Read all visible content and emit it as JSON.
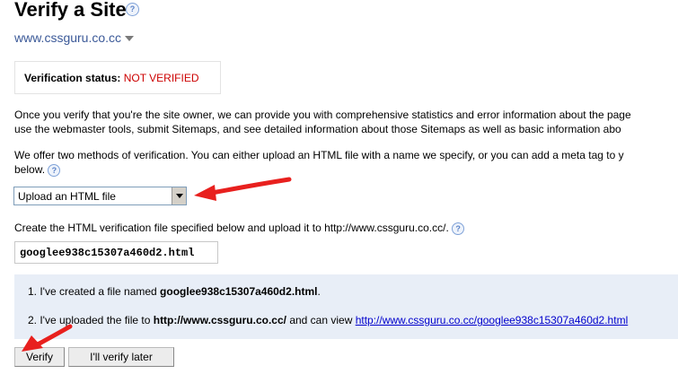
{
  "page": {
    "title": "Verify a Site",
    "help_glyph": "?",
    "site_name": "www.cssguru.co.cc"
  },
  "status": {
    "label": "Verification status:",
    "value": "NOT VERIFIED",
    "value_color": "#cc0000"
  },
  "intro": {
    "line1": "Once you verify that you're the site owner, we can provide you with comprehensive statistics and error information about the page",
    "line2": "use the webmaster tools, submit Sitemaps, and see detailed information about those Sitemaps as well as basic information abo"
  },
  "methods": {
    "line1": "We offer two methods of verification. You can either upload an HTML file with a name we specify, or you can add a meta tag to y",
    "line2": "below."
  },
  "method_select": {
    "selected": "Upload an HTML file"
  },
  "create_instruction": "Create the HTML verification file specified below and upload it to http://www.cssguru.co.cc/.",
  "verification_filename": "googlee938c15307a460d2.html",
  "steps": {
    "step1_prefix": "1. I've created a file named ",
    "step1_file": "googlee938c15307a460d2.html",
    "step1_suffix": ".",
    "step2_prefix": "2. I've uploaded the file to ",
    "step2_site": "http://www.cssguru.co.cc/",
    "step2_middle": " and can view ",
    "step2_link": "http://www.cssguru.co.cc/googlee938c15307a460d2.html"
  },
  "buttons": {
    "verify": "Verify",
    "later": "I'll verify later"
  },
  "colors": {
    "link": "#0000cc",
    "site_link": "#3b5998",
    "steps_background": "#e8eef7",
    "annotation_arrow": "#e8201e"
  }
}
